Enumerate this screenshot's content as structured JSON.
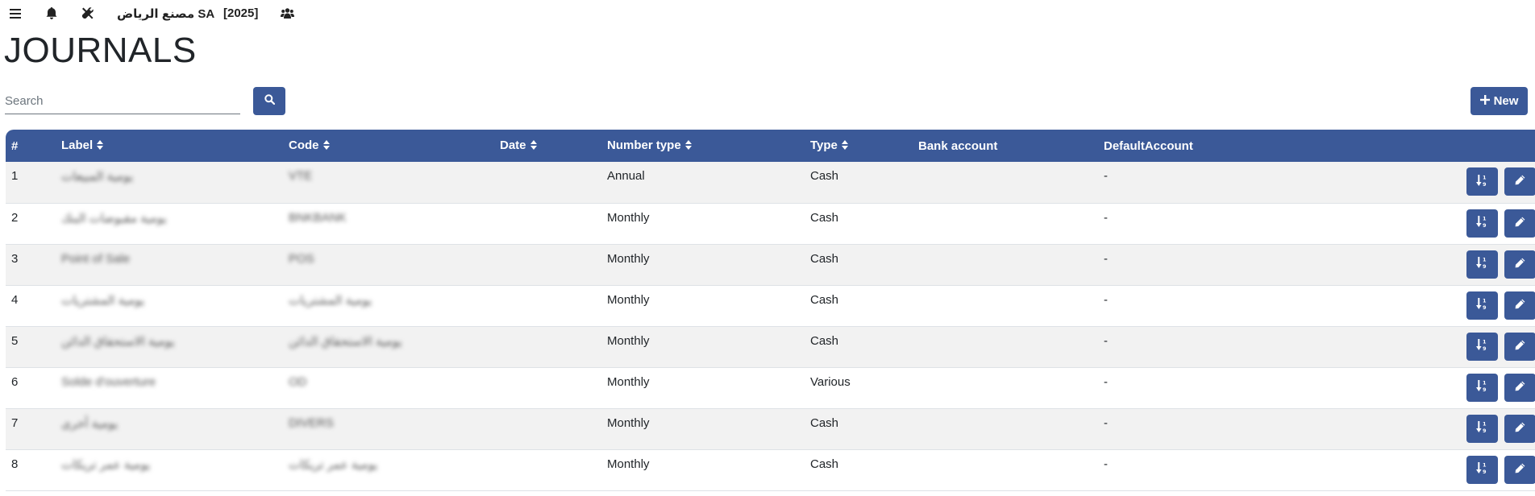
{
  "topbar": {
    "company": "مصنع الرياض SA",
    "year": "[2025]",
    "icons": [
      "menu-icon",
      "bell-icon",
      "tools-icon",
      "users-icon"
    ]
  },
  "page": {
    "title": "JOURNALS"
  },
  "search": {
    "placeholder": "Search"
  },
  "toolbar": {
    "new_label": "New"
  },
  "table": {
    "columns": [
      "#",
      "Label",
      "Code",
      "Date",
      "Number type",
      "Type",
      "Bank account",
      "DefaultAccount"
    ],
    "rows": [
      {
        "num": "1",
        "label": "يومية المبيعات",
        "code": "VTE",
        "date": "",
        "number_type": "Annual",
        "type": "Cash",
        "bank_account": "",
        "default_account": "-"
      },
      {
        "num": "2",
        "label": "يومية مقبوضات البنك",
        "code": "BNKBANK",
        "date": "",
        "number_type": "Monthly",
        "type": "Cash",
        "bank_account": "",
        "default_account": "-"
      },
      {
        "num": "3",
        "label": "Point of Sale",
        "code": "POS",
        "date": "",
        "number_type": "Monthly",
        "type": "Cash",
        "bank_account": "",
        "default_account": "-"
      },
      {
        "num": "4",
        "label": "يومية المشتريات",
        "code": "يومية المشتريات",
        "date": "",
        "number_type": "Monthly",
        "type": "Cash",
        "bank_account": "",
        "default_account": "-"
      },
      {
        "num": "5",
        "label": "يومية الاستحقاق الدائن",
        "code": "يومية الاستحقاق الدائن",
        "date": "",
        "number_type": "Monthly",
        "type": "Cash",
        "bank_account": "",
        "default_account": "-"
      },
      {
        "num": "6",
        "label": "Solde d'ouverture",
        "code": "OD",
        "date": "",
        "number_type": "Monthly",
        "type": "Various",
        "bank_account": "",
        "default_account": "-"
      },
      {
        "num": "7",
        "label": "يومية أخرى",
        "code": "DIVERS",
        "date": "",
        "number_type": "Monthly",
        "type": "Cash",
        "bank_account": "",
        "default_account": "-"
      },
      {
        "num": "8",
        "label": "يومية عمر تريكات",
        "code": "يومية عمر تريكات",
        "date": "",
        "number_type": "Monthly",
        "type": "Cash",
        "bank_account": "",
        "default_account": "-"
      }
    ]
  },
  "colors": {
    "primary": "#3b5998",
    "danger": "#dc3545",
    "row_alt": "#f2f2f2"
  }
}
